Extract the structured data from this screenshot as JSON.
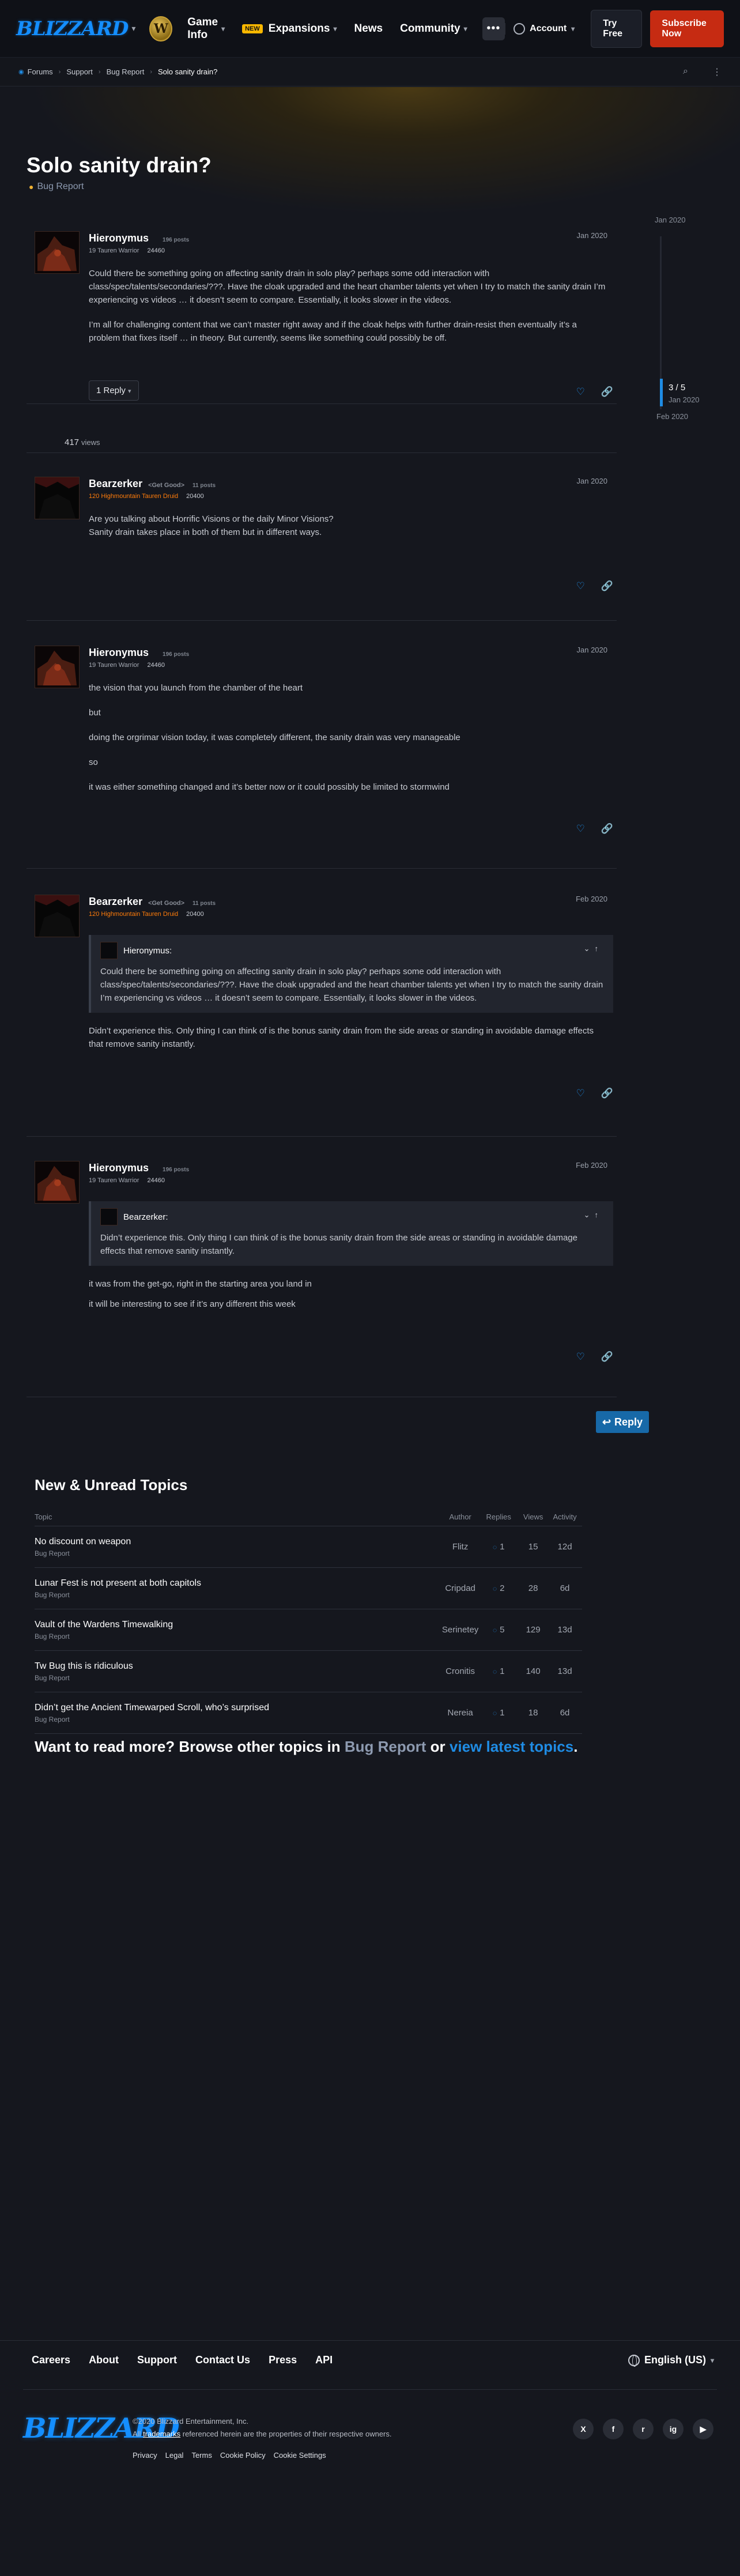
{
  "nav": {
    "logo": "BLIZZARD",
    "links": [
      "Game Info",
      "Expansions",
      "News",
      "Community"
    ],
    "new_badge": "NEW",
    "more": "•••",
    "account": "Account",
    "try_free": "Try Free",
    "subscribe": "Subscribe Now",
    "accent": "#148eff",
    "subscribe_color": "#c62b12"
  },
  "breadcrumb": [
    "Forums",
    "Support",
    "Bug Report",
    "Solo sanity drain?"
  ],
  "topic": {
    "title": "Solo sanity drain?",
    "category": "Bug Report"
  },
  "timeline": {
    "start": "Jan 2020",
    "position": "3 / 5",
    "current": "Jan 2020",
    "end": "Feb 2020"
  },
  "posts": [
    {
      "author": "Hieronymus",
      "title": "",
      "post_count": "196 posts",
      "class": "19 Tauren Warrior",
      "score": "24460",
      "date": "Jan 2020",
      "paragraphs": [
        "Could there be something going on affecting sanity drain in solo play? perhaps some odd interaction with class/spec/talents/secondaries/???. Have the cloak upgraded and the heart chamber talents yet when I try to match the sanity drain I’m experiencing vs videos … it doesn’t seem to compare. Essentially, it looks slower in the videos.",
        "I’m all for challenging content that we can’t master right away and if the cloak helps with further drain-resist then eventually it’s a problem that fixes itself … in theory. But currently, seems like something could possibly be off."
      ],
      "reply_toggle": "1 Reply"
    },
    {
      "author": "Bearzerker",
      "title": "<Get Good>",
      "post_count": "11 posts",
      "class": "120 Highmountain Tauren Druid",
      "score": "20400",
      "date": "Jan 2020",
      "paragraphs": [
        "Are you talking about Horrific Visions or the daily Minor Visions?",
        "Sanity drain takes place in both of them but in different ways."
      ]
    },
    {
      "author": "Hieronymus",
      "title": "",
      "post_count": "196 posts",
      "class": "19 Tauren Warrior",
      "score": "24460",
      "date": "Jan 2020",
      "paragraphs": [
        "the vision that you launch from the chamber of the heart",
        "but",
        "doing the orgrimar vision today, it was completely different, the sanity drain was very manageable",
        "so",
        "it was either something changed and it’s better now or it could possibly be limited to stormwind"
      ]
    },
    {
      "author": "Bearzerker",
      "title": "<Get Good>",
      "post_count": "11 posts",
      "class": "120 Highmountain Tauren Druid",
      "score": "20400",
      "date": "Feb 2020",
      "quote_author": "Hieronymus:",
      "quote": "Could there be something going on affecting sanity drain in solo play? perhaps some odd interaction with class/spec/talents/secondaries/???. Have the cloak upgraded and the heart chamber talents yet when I try to match the sanity drain I’m experiencing vs videos … it doesn’t seem to compare. Essentially, it looks slower in the videos.",
      "paragraphs": [
        "Didn’t experience this. Only thing I can think of is the bonus sanity drain from the side areas or standing in avoidable damage effects that remove sanity instantly."
      ]
    },
    {
      "author": "Hieronymus",
      "title": "",
      "post_count": "196 posts",
      "class": "19 Tauren Warrior",
      "score": "24460",
      "date": "Feb 2020",
      "quote_author": "Bearzerker:",
      "quote": "Didn’t experience this. Only thing I can think of is the bonus sanity drain from the side areas or standing in avoidable damage effects that remove sanity instantly.",
      "paragraphs": [
        "it was from the get-go, right in the starting area you land in",
        "it will be interesting to see if it’s any different this week"
      ]
    }
  ],
  "views": {
    "count": "417",
    "label": "views"
  },
  "reply_button": "Reply",
  "new_unread": {
    "heading": "New & Unread Topics",
    "columns": [
      "Topic",
      "Author",
      "Replies",
      "Views",
      "Activity"
    ],
    "rows": [
      {
        "title": "No discount on weapon",
        "category": "Bug Report",
        "author": "Flitz",
        "replies": "1",
        "views": "15",
        "activity": "12d"
      },
      {
        "title": "Lunar Fest is not present at both capitols",
        "category": "Bug Report",
        "author": "Cripdad",
        "replies": "2",
        "views": "28",
        "activity": "6d"
      },
      {
        "title": "Vault of the Wardens Timewalking",
        "category": "Bug Report",
        "author": "Serinetey",
        "replies": "5",
        "views": "129",
        "activity": "13d"
      },
      {
        "title": "Tw Bug this is ridiculous",
        "category": "Bug Report",
        "author": "Cronitis",
        "replies": "1",
        "views": "140",
        "activity": "13d"
      },
      {
        "title": "Didn’t get the Ancient Timewarped Scroll, who’s surprised",
        "category": "Bug Report",
        "author": "Nereia",
        "replies": "1",
        "views": "18",
        "activity": "6d"
      }
    ]
  },
  "browse": {
    "prefix": "Want to read more? Browse other topics in",
    "category": "Bug Report",
    "or": "or",
    "latest": "view latest topics",
    "suffix": "."
  },
  "footer": {
    "links": [
      "Careers",
      "About",
      "Support",
      "Contact Us",
      "Press",
      "API"
    ],
    "language": "English (US)",
    "logo": "BLIZZARD",
    "copyright": "©2020 Blizzard Entertainment, Inc.",
    "trademark_pre": "All",
    "trademark_link": "trademarks",
    "trademark_post": "referenced herein are the properties of their respective owners.",
    "legal_links": [
      "Privacy",
      "Legal",
      "Terms",
      "Cookie Policy",
      "Cookie Settings"
    ],
    "socials": [
      "X",
      "f",
      "r",
      "ig",
      "▶"
    ]
  }
}
